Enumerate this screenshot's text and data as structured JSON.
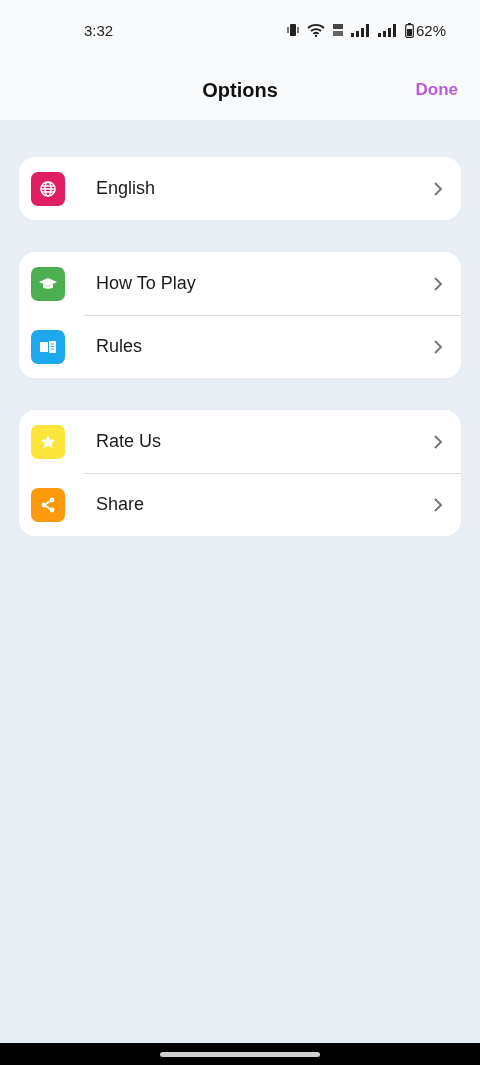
{
  "status_bar": {
    "time": "3:32",
    "battery": "62%"
  },
  "header": {
    "title": "Options",
    "action": "Done"
  },
  "groups": [
    {
      "items": [
        {
          "label": "English",
          "kind": "globe",
          "color": "#e01e63"
        }
      ]
    },
    {
      "items": [
        {
          "label": "How To Play",
          "kind": "cap",
          "color": "#4caf50"
        },
        {
          "label": "Rules",
          "kind": "book",
          "color": "#1da7ec"
        }
      ]
    },
    {
      "items": [
        {
          "label": "Rate Us",
          "kind": "star",
          "color": "#fce63c"
        },
        {
          "label": "Share",
          "kind": "share",
          "color": "#fb9a0c"
        }
      ]
    }
  ]
}
